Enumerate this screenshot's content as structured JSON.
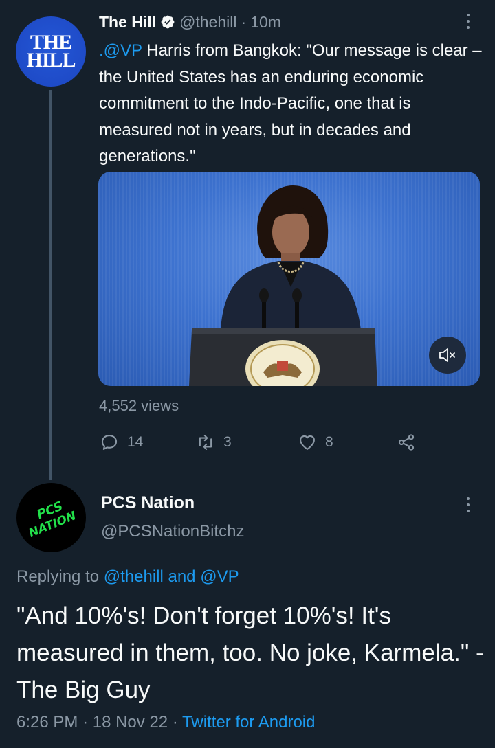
{
  "tweet": {
    "author_name": "The Hill",
    "author_handle": "@thehill",
    "time_ago": "10m",
    "avatar_line1": "THE",
    "avatar_line2": "HILL",
    "mention": ".@VP",
    "text": " Harris from Bangkok: \"Our message is clear – the United States has an enduring economic commitment to the Indo-Pacific, one that is measured not in years, but in decades and generations.\"",
    "views": "4,552 views",
    "replies": "14",
    "retweets": "3",
    "likes": "8"
  },
  "reply": {
    "author_name": "PCS Nation",
    "author_handle": "@PCSNationBitchz",
    "avatar_line1": "PCS",
    "avatar_line2": "NATION",
    "replying_prefix": "Replying to ",
    "replying_mentions": "@thehill and @VP",
    "text": "\"And 10%'s! Don't forget 10%'s! It's measured in them, too. No joke, Karmela.\" - The Big Guy",
    "time": "6:26 PM",
    "date": "18 Nov 22",
    "source": "Twitter for Android"
  },
  "colors": {
    "background": "#15202b",
    "accent": "#1d9bf0",
    "secondary_text": "#8b98a5"
  },
  "icons": [
    "verified-icon",
    "more-options-icon",
    "mute-icon",
    "reply-icon",
    "retweet-icon",
    "like-icon",
    "share-icon"
  ]
}
